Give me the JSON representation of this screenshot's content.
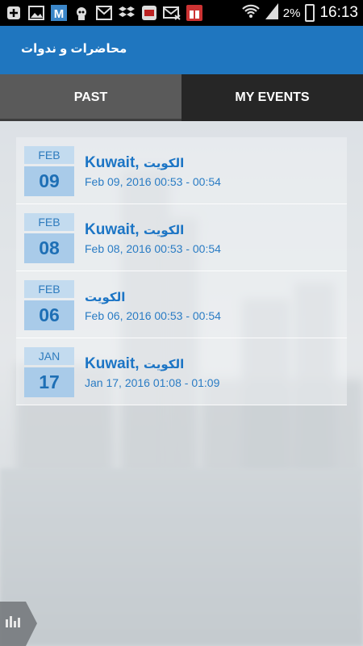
{
  "status_bar": {
    "battery": "2%",
    "time": "16:13",
    "icons": [
      "add-icon",
      "image-icon",
      "m-app-icon",
      "pirate-icon",
      "gmail-icon",
      "dropbox-icon",
      "game-icon",
      "mail-icon",
      "gift-icon",
      "wifi-icon",
      "signal-icon",
      "battery-icon"
    ]
  },
  "header": {
    "title": "محاضرات و ندوات"
  },
  "tabs": [
    {
      "label": "PAST"
    },
    {
      "label": "MY EVENTS"
    }
  ],
  "events": [
    {
      "month": "FEB",
      "day": "09",
      "title_en": "Kuwait",
      "title_sep": ",",
      "title_ar": "الكويت",
      "time": "Feb 09, 2016 00:53 - 00:54"
    },
    {
      "month": "FEB",
      "day": "08",
      "title_en": "Kuwait",
      "title_sep": ",",
      "title_ar": "الكويت",
      "time": "Feb 08, 2016 00:53 - 00:54"
    },
    {
      "month": "FEB",
      "day": "06",
      "title_en": "",
      "title_sep": "",
      "title_ar": "الكويت",
      "time": "Feb 06, 2016 00:53 - 00:54"
    },
    {
      "month": "JAN",
      "day": "17",
      "title_en": "Kuwait",
      "title_sep": ",",
      "title_ar": "الكويت",
      "time": "Jan 17, 2016 01:08 - 01:09"
    }
  ],
  "colors": {
    "accent": "#1f76bf",
    "tab_active": "#5a5a5a",
    "tab_inactive": "#262626",
    "date_day_bg": "#a9cbe9"
  }
}
